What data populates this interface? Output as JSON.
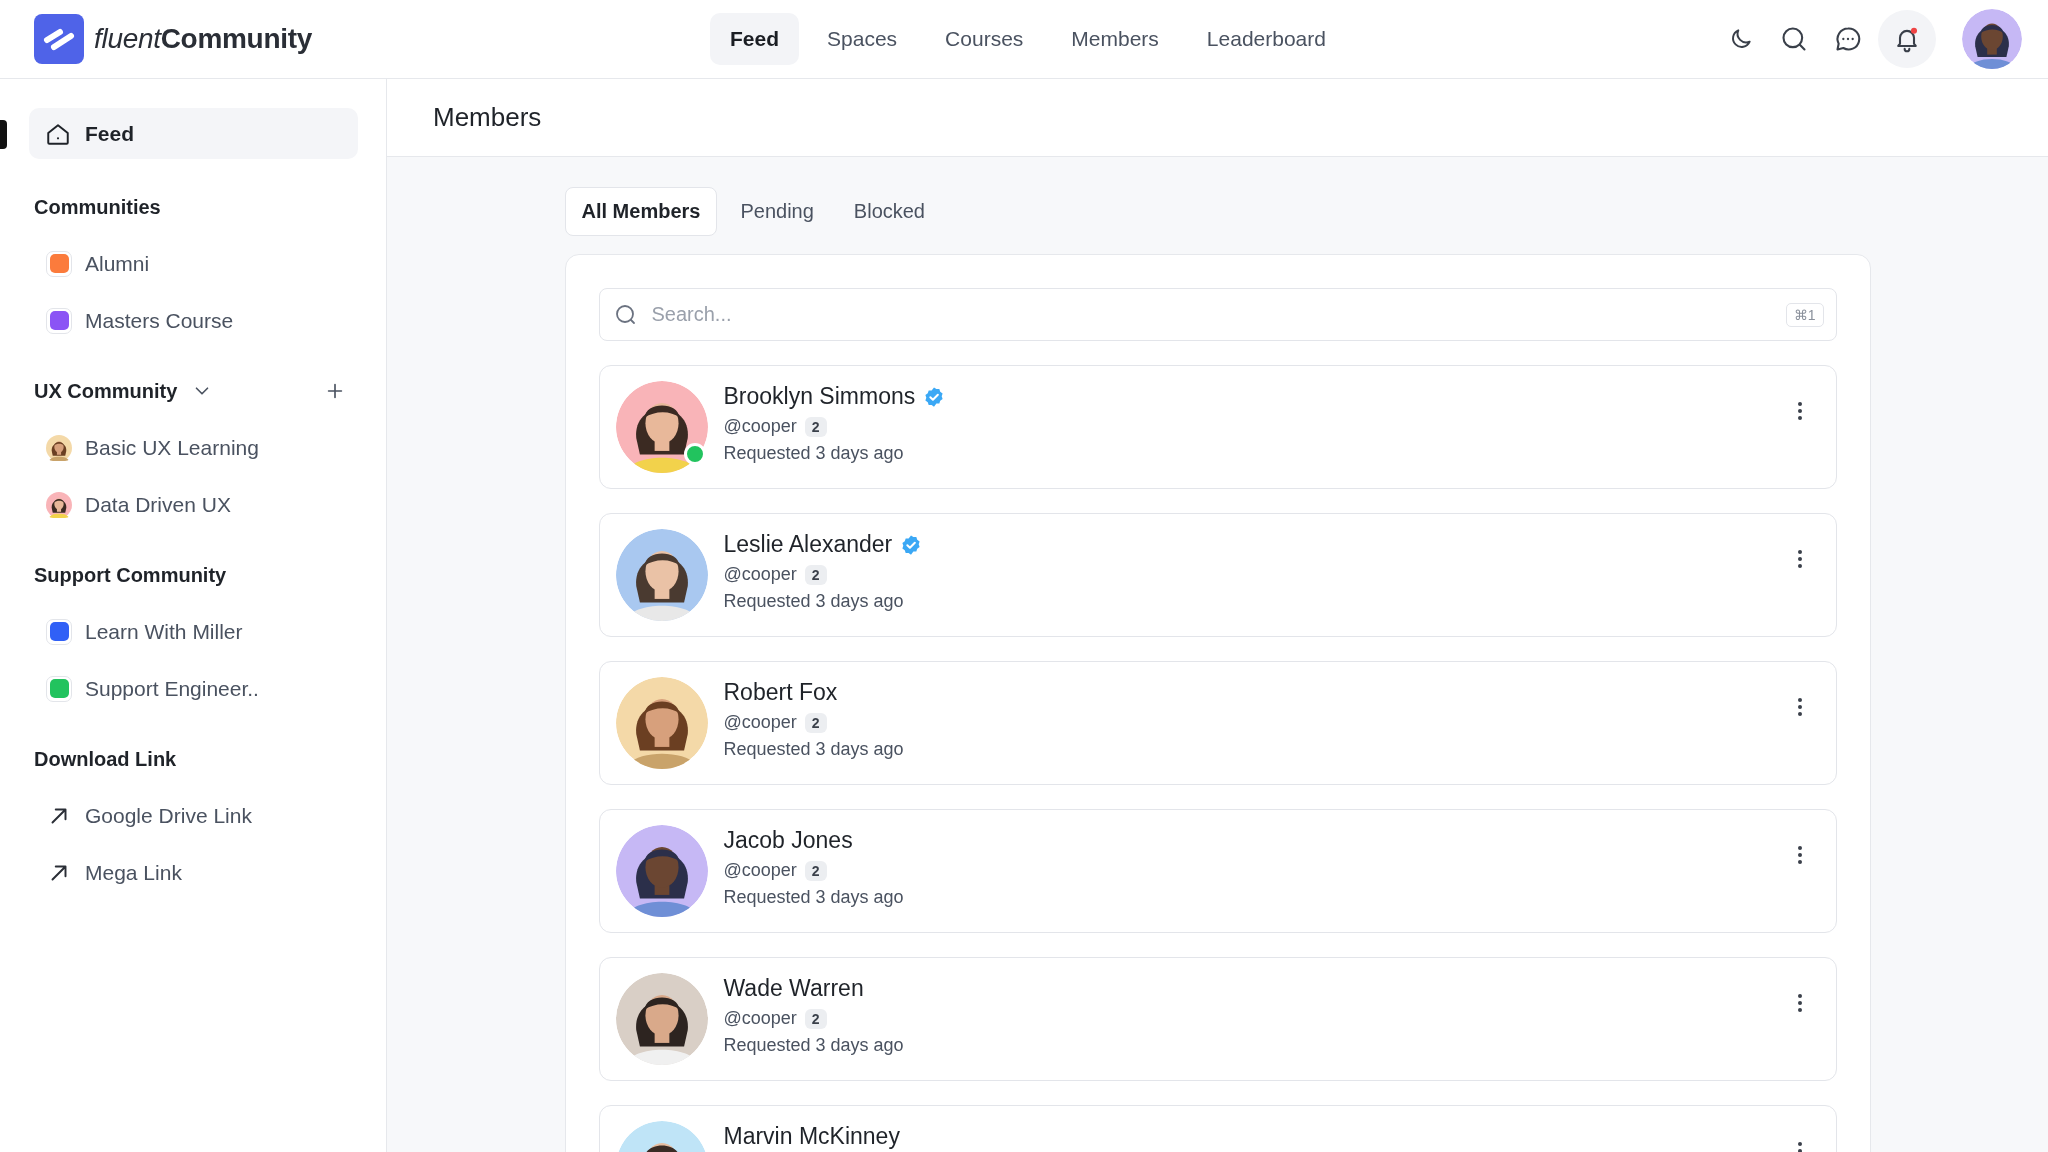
{
  "brand": {
    "prefix": "fluent",
    "name": "Community"
  },
  "nav": [
    {
      "label": "Feed",
      "selected": true
    },
    {
      "label": "Spaces",
      "selected": false
    },
    {
      "label": "Courses",
      "selected": false
    },
    {
      "label": "Members",
      "selected": false
    },
    {
      "label": "Leaderboard",
      "selected": false
    }
  ],
  "header_actions": {
    "notification": true
  },
  "sidebar": {
    "items": [
      {
        "label": "Feed",
        "selected": true
      }
    ],
    "sections": [
      {
        "title": "Communities",
        "items": [
          {
            "kind": "color",
            "label": "Alumni",
            "color": "#fb7b3c"
          },
          {
            "kind": "color",
            "label": "Masters Course",
            "color": "#8b54f5"
          }
        ]
      },
      {
        "title": "UX Community",
        "expanded": true,
        "items": [
          {
            "kind": "avatar",
            "label": "Basic UX Learning"
          },
          {
            "kind": "avatar",
            "label": "Data Driven UX"
          }
        ]
      },
      {
        "title": "Support Community",
        "items": [
          {
            "kind": "color",
            "label": "Learn With Miller",
            "color": "#3060f6"
          },
          {
            "kind": "color",
            "label": "Support Engineer..",
            "color": "#22c35e"
          }
        ]
      },
      {
        "title": "Download Link",
        "items": [
          {
            "kind": "link",
            "label": "Google Drive Link"
          },
          {
            "kind": "link",
            "label": "Mega Link"
          }
        ]
      }
    ]
  },
  "page": {
    "title": "Members"
  },
  "tabs": [
    {
      "label": "All Members",
      "selected": true
    },
    {
      "label": "Pending",
      "selected": false
    },
    {
      "label": "Blocked",
      "selected": false
    }
  ],
  "search": {
    "placeholder": "Search...",
    "shortcut": "⌘1"
  },
  "members": [
    {
      "name": "Brooklyn Simmons",
      "verified": true,
      "online": true,
      "handle": "@cooper",
      "badge": "2",
      "requested": "Requested 3 days ago"
    },
    {
      "name": "Leslie Alexander",
      "verified": true,
      "online": false,
      "handle": "@cooper",
      "badge": "2",
      "requested": "Requested 3 days ago"
    },
    {
      "name": "Robert Fox",
      "verified": false,
      "online": false,
      "handle": "@cooper",
      "badge": "2",
      "requested": "Requested 3 days ago"
    },
    {
      "name": "Jacob Jones",
      "verified": false,
      "online": false,
      "handle": "@cooper",
      "badge": "2",
      "requested": "Requested 3 days ago"
    },
    {
      "name": "Wade Warren",
      "verified": false,
      "online": false,
      "handle": "@cooper",
      "badge": "2",
      "requested": "Requested 3 days ago"
    },
    {
      "name": "Marvin McKinney",
      "verified": false,
      "online": false
    }
  ]
}
